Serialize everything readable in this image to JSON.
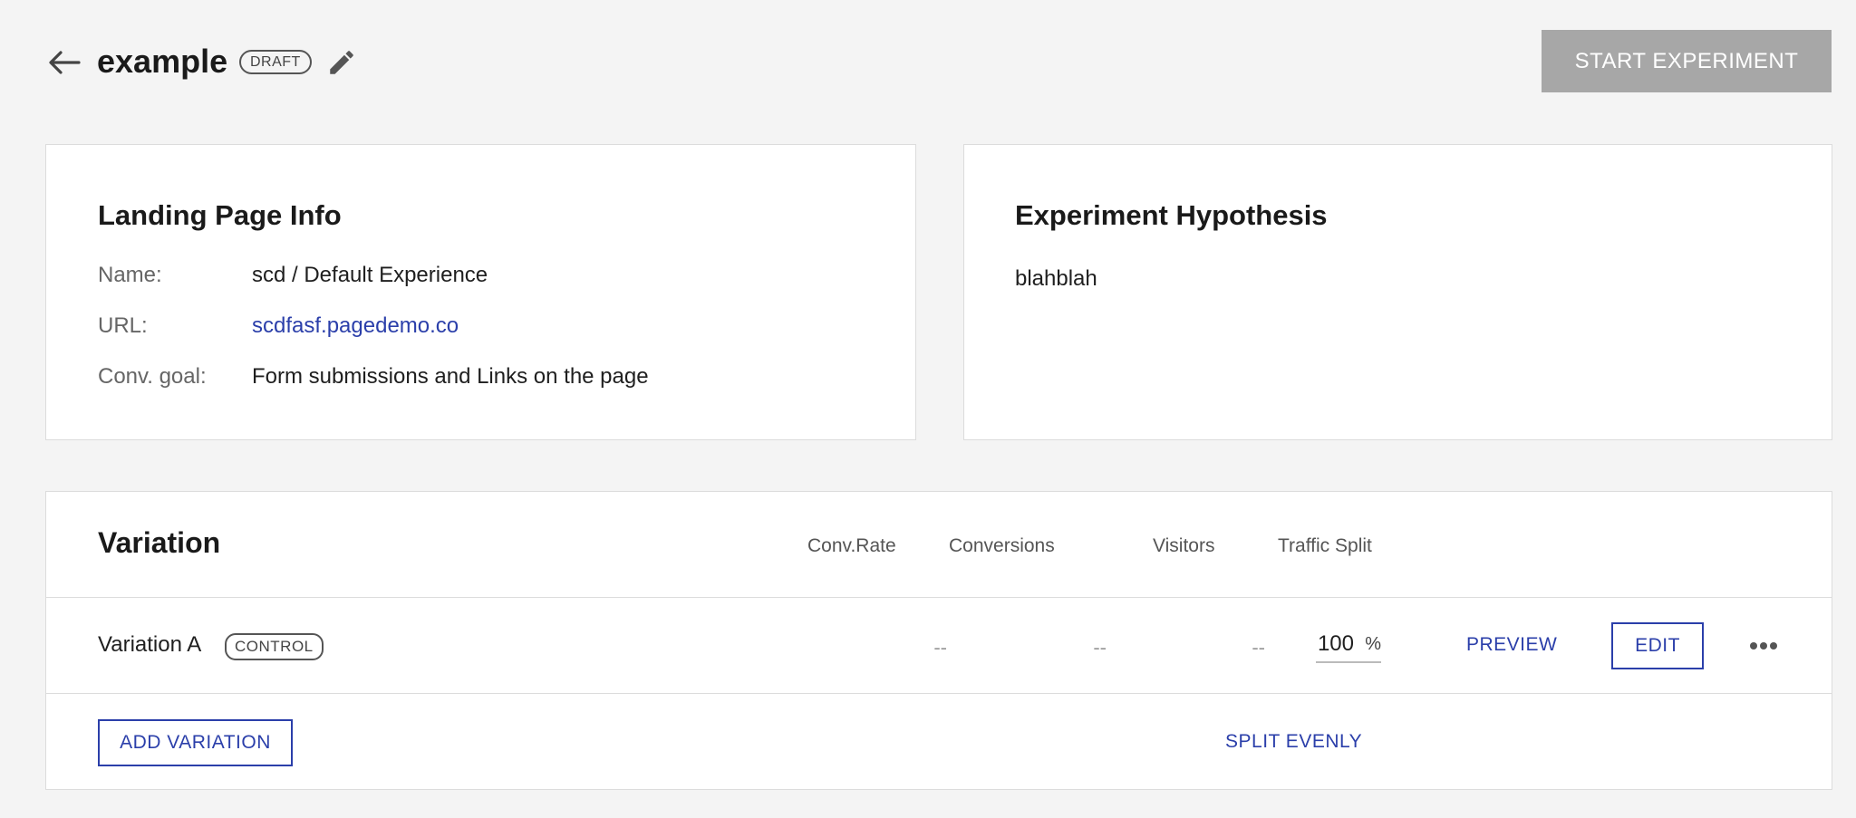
{
  "header": {
    "title": "example",
    "status_badge": "DRAFT",
    "start_button_label": "START EXPERIMENT"
  },
  "landing_page_info": {
    "title": "Landing Page Info",
    "fields": [
      {
        "label": "Name:",
        "value": "scd / Default Experience"
      },
      {
        "label": "URL:",
        "value": "scdfasf.pagedemo.co"
      },
      {
        "label": "Conv. goal:",
        "value": "Form submissions and Links on the page"
      }
    ]
  },
  "hypothesis": {
    "title": "Experiment Hypothesis",
    "text": "blahblah"
  },
  "variations": {
    "title": "Variation",
    "columns": {
      "conv_rate": "Conv.Rate",
      "conversions": "Conversions",
      "visitors": "Visitors",
      "traffic_split": "Traffic Split"
    },
    "rows": [
      {
        "name": "Variation A",
        "badge": "CONTROL",
        "conv_rate": "--",
        "conversions": "--",
        "visitors": "--",
        "traffic_split": "100",
        "split_unit": "%",
        "preview_label": "PREVIEW",
        "edit_label": "EDIT"
      }
    ],
    "add_variation_label": "ADD VARIATION",
    "split_evenly_label": "SPLIT EVENLY"
  },
  "colors": {
    "background": "#f4f4f4",
    "accent": "#2b3faa",
    "disabled_button": "#a7a7a7"
  },
  "icons": {
    "back": "arrow-left-icon",
    "edit_title": "pencil-icon",
    "more": "more-horizontal-icon"
  }
}
